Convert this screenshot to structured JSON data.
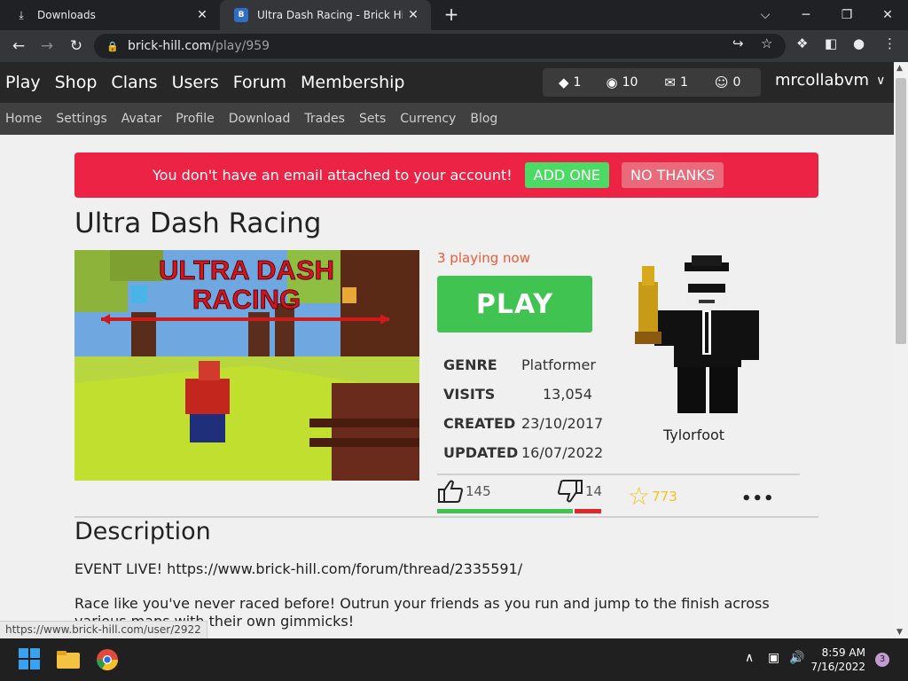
{
  "browser": {
    "tabs": [
      {
        "label": "Downloads",
        "icon": "download-icon"
      },
      {
        "label": "Ultra Dash Racing - Brick Hill",
        "icon": "brick-hill-favicon"
      }
    ],
    "favicon_letter": "B",
    "url_host": "brick-hill.com",
    "url_path": "/play/959"
  },
  "site": {
    "main_nav": [
      "Play",
      "Shop",
      "Clans",
      "Users",
      "Forum",
      "Membership"
    ],
    "stats": {
      "bricks": "1",
      "bits": "10",
      "messages": "1",
      "friends": "0"
    },
    "username": "mrcollabvm",
    "sub_nav": [
      "Home",
      "Settings",
      "Avatar",
      "Profile",
      "Download",
      "Trades",
      "Sets",
      "Currency",
      "Blog"
    ]
  },
  "alert": {
    "message": "You don't have an email attached to your account!",
    "add_label": "ADD ONE",
    "dismiss_label": "NO THANKS"
  },
  "game": {
    "title": "Ultra Dash Racing",
    "thumb_title_line1": "ULTRA DASH",
    "thumb_title_line2": "RACING",
    "playing": "3 playing now",
    "play_label": "PLAY",
    "genre_label": "GENRE",
    "genre": "Platformer",
    "visits_label": "VISITS",
    "visits": "13,054",
    "created_label": "CREATED",
    "created": "23/10/2017",
    "updated_label": "UPDATED",
    "updated": "16/07/2022",
    "creator": "Tylorfoot",
    "likes": "145",
    "dislikes": "14",
    "like_fraction": 0.912,
    "favorites": "773",
    "more_label": "•••"
  },
  "description": {
    "heading": "Description",
    "line1": "EVENT LIVE! https://www.brick-hill.com/forum/thread/2335591/",
    "line2": "Race like you've never raced before! Outrun your friends as you run and jump to the finish across various maps with their own gimmicks!"
  },
  "status_link": "https://www.brick-hill.com/user/2922",
  "taskbar": {
    "time": "8:59 AM",
    "date": "7/16/2022",
    "notifications": "3"
  },
  "colors": {
    "alert_red": "#ed2346",
    "play_green": "#41c352",
    "playing_orange": "#ef5a3a",
    "fav_yellow": "#f5c21b"
  }
}
